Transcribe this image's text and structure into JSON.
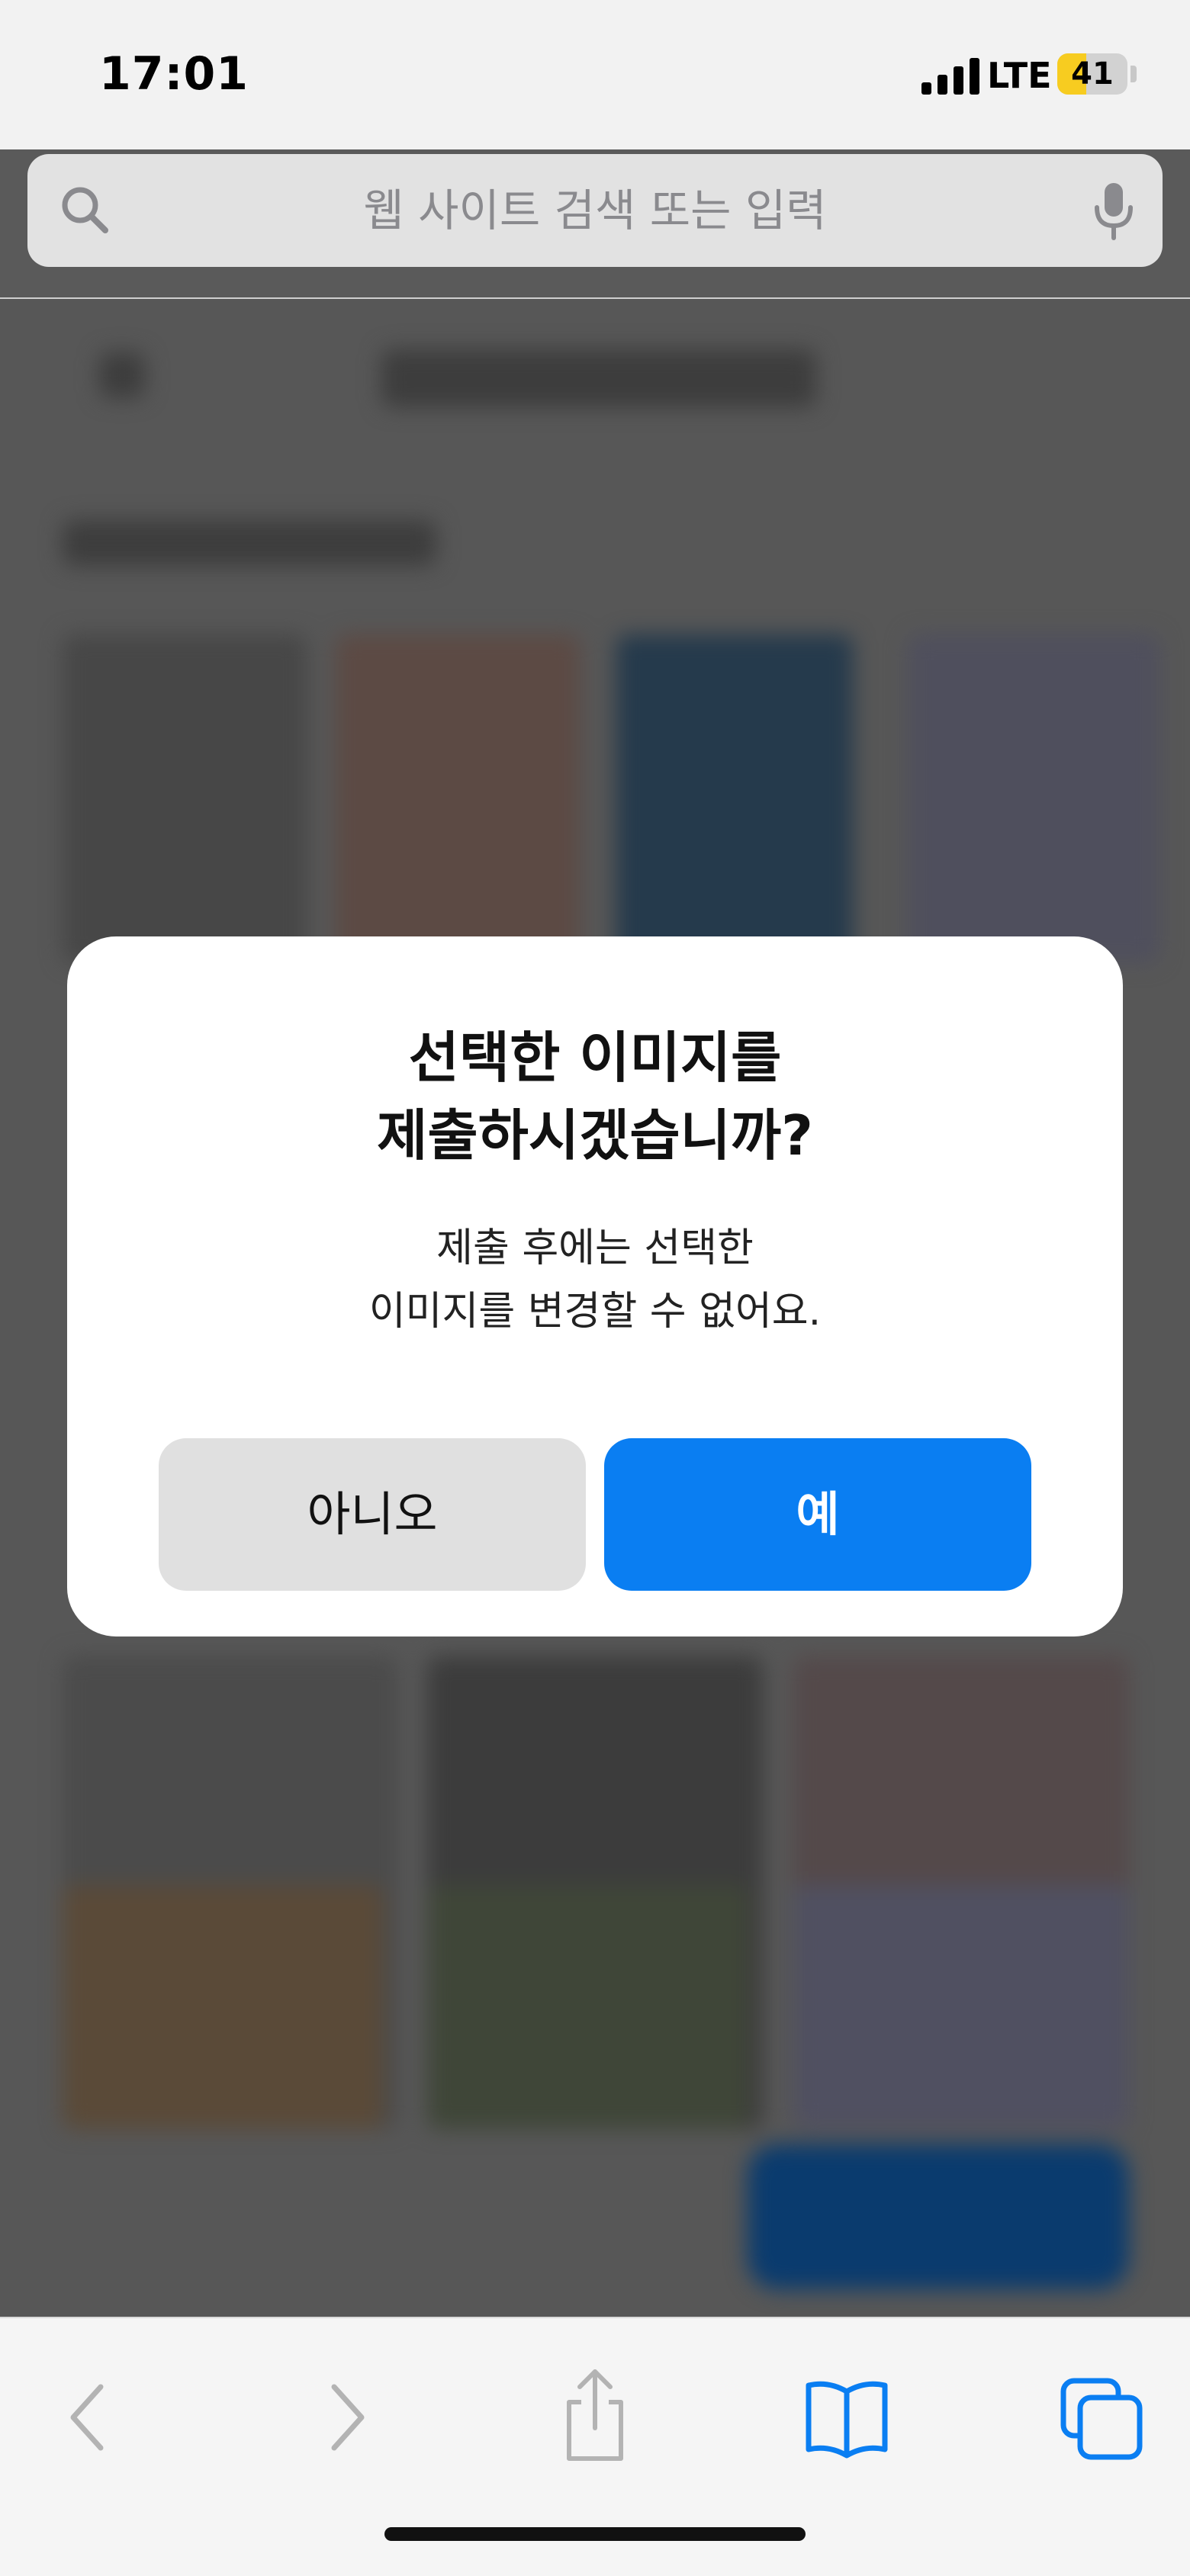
{
  "status_bar": {
    "time": "17:01",
    "network": "LTE",
    "battery_level": "41",
    "battery_fraction": 0.41,
    "signal_icon": "signal-bars-icon"
  },
  "address_bar": {
    "placeholder": "웹 사이트 검색 또는 입력",
    "search_icon": "search-icon",
    "mic_icon": "microphone-icon"
  },
  "dialog": {
    "title_line1": "선택한 이미지를",
    "title_line2": "제출하시겠습니까?",
    "body_line1": "제출 후에는 선택한",
    "body_line2": "이미지를 변경할 수 없어요.",
    "no_label": "아니오",
    "yes_label": "예"
  },
  "toolbar": {
    "back_icon": "chevron-left-icon",
    "forward_icon": "chevron-right-icon",
    "share_icon": "share-icon",
    "bookmarks_icon": "book-icon",
    "tabs_icon": "tabs-icon"
  },
  "colors": {
    "accent": "#0a7ef2",
    "battery": "#f7cc20",
    "overlay": "#5a5a5a"
  }
}
